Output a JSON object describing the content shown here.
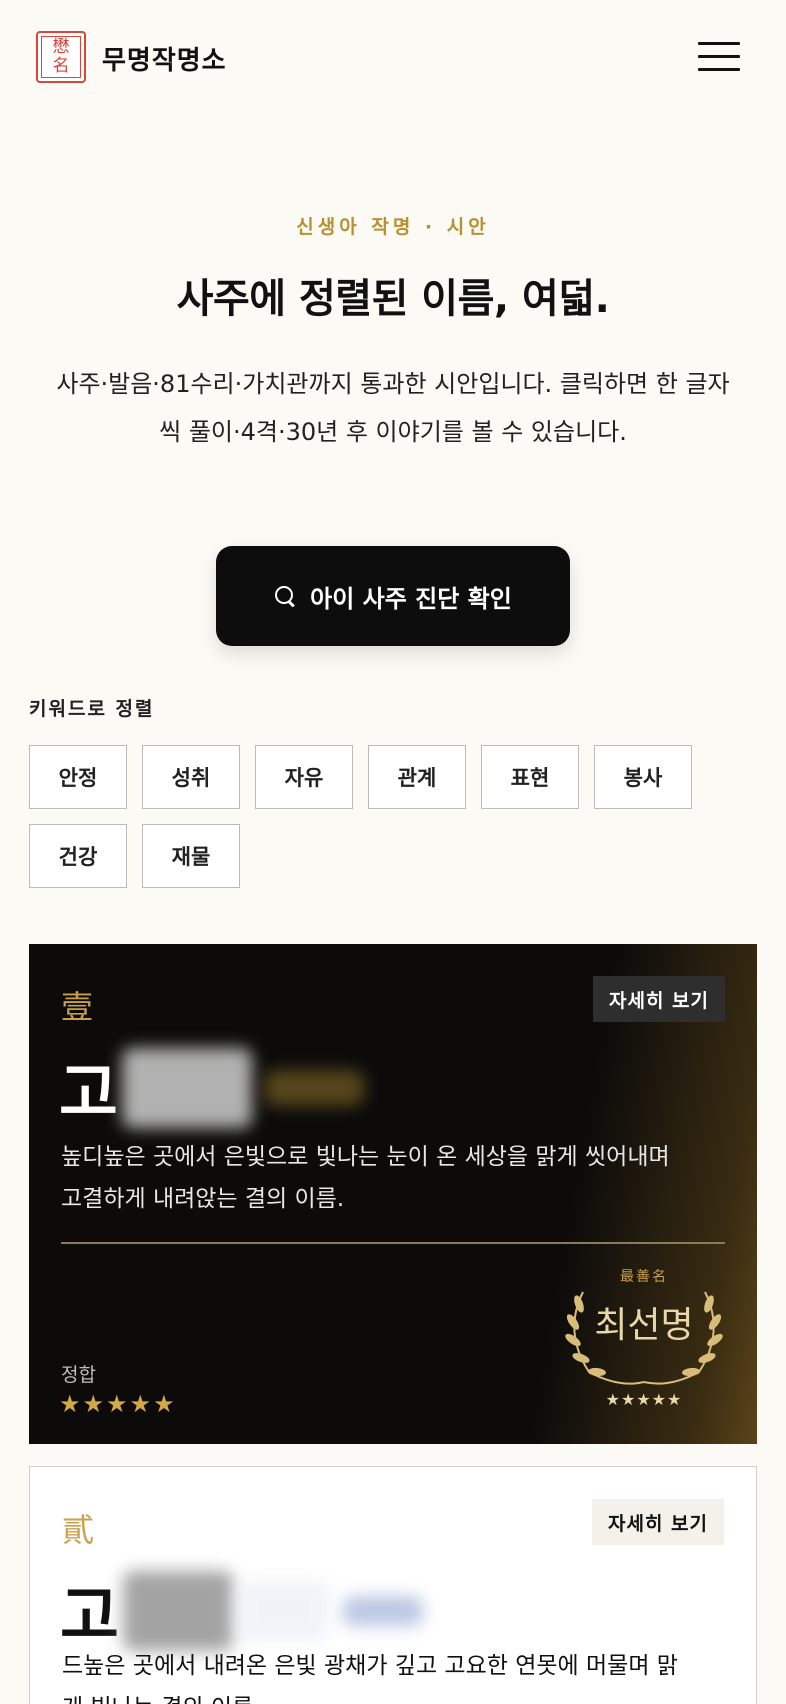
{
  "header": {
    "logo_text": [
      "懋",
      "名"
    ],
    "brand": "무명작명소"
  },
  "hero": {
    "eyebrow": "신생아 작명 · 시안",
    "title": "사주에 정렬된 이름, 여덟.",
    "description": "사주·발음·81수리·가치관까지 통과한 시안입니다. 클릭하면 한 글자씩 풀이·4격·30년 후 이야기를 볼 수 있습니다.",
    "cta_label": "아이 사주 진단 확인"
  },
  "keywords": {
    "label": "키워드로 정렬",
    "items": [
      "안정",
      "성취",
      "자유",
      "관계",
      "표현",
      "봉사",
      "건강",
      "재물"
    ]
  },
  "cards": [
    {
      "rank": "壹",
      "detail_label": "자세히 보기",
      "surname": "고",
      "summary": "높디높은 곳에서 은빛으로 빛나는 눈이 온 세상을 맑게 씻어내며 고결하게 내려앉는 결의 이름.",
      "fit_label": "정합",
      "fit_stars": "★★★★★",
      "badge_small": "最善名",
      "badge_main": "최선명",
      "badge_stars": "★★★★★"
    },
    {
      "rank": "貳",
      "detail_label": "자세히 보기",
      "surname": "고",
      "summary": "드높은 곳에서 내려온 은빛 광채가 깊고 고요한 연못에 머물며 맑게 빛나는 결의 이름."
    }
  ]
}
